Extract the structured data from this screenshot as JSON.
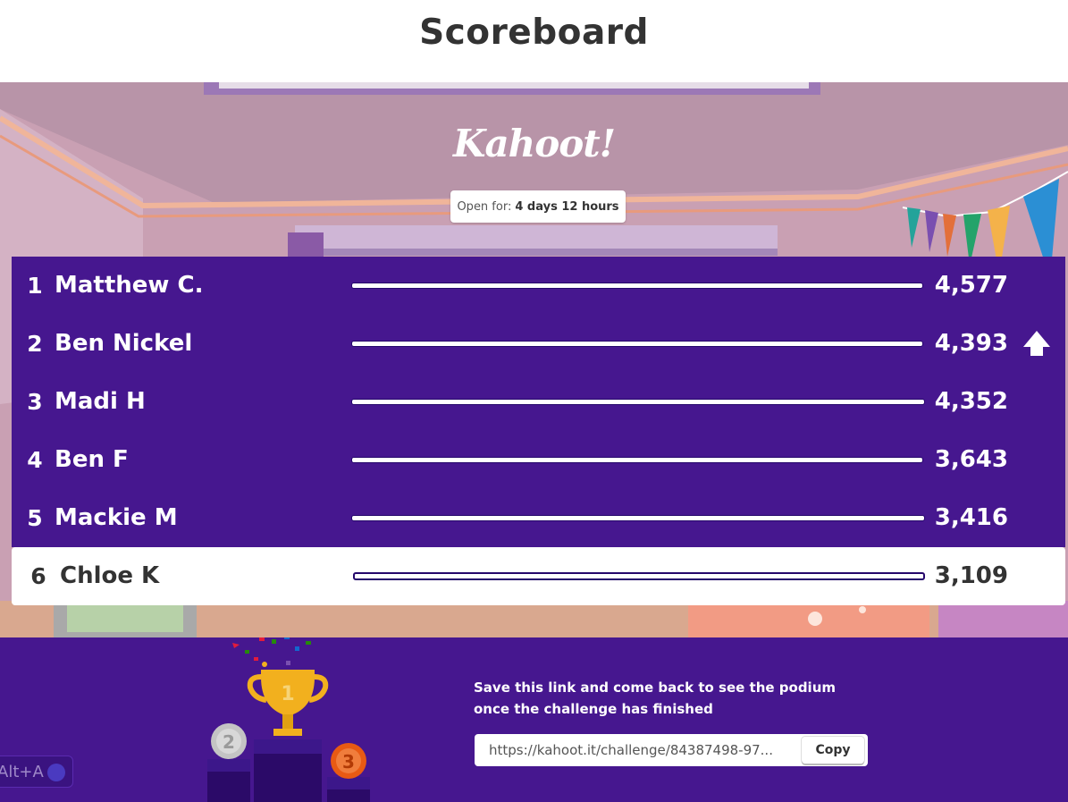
{
  "header": {
    "title": "Scoreboard"
  },
  "brand": {
    "logo_text": "Kahoot!"
  },
  "open_for": {
    "label": "Open for:",
    "value": "4 days 12 hours"
  },
  "leaderboard": [
    {
      "rank": "1",
      "name": "Matthew C.",
      "score": "4,577",
      "progress": 1.0,
      "trend": ""
    },
    {
      "rank": "2",
      "name": "Ben Nickel",
      "score": "4,393",
      "progress": 1.0,
      "trend": "up"
    },
    {
      "rank": "3",
      "name": "Madi H",
      "score": "4,352",
      "progress": 1.0,
      "trend": ""
    },
    {
      "rank": "4",
      "name": "Ben F",
      "score": "3,643",
      "progress": 1.0,
      "trend": ""
    },
    {
      "rank": "5",
      "name": "Mackie M",
      "score": "3,416",
      "progress": 1.0,
      "trend": ""
    },
    {
      "rank": "6",
      "name": "Chloe K",
      "score": "3,109",
      "progress": 1.0,
      "trend": "",
      "is_current_player": true
    }
  ],
  "footer": {
    "message": "Save this link and come back to see the podium once the challenge has finished",
    "link": "https://kahoot.it/challenge/84387498-97...",
    "copy_label": "Copy",
    "podium_labels": [
      "1",
      "2",
      "3"
    ]
  },
  "accessibility_badge": {
    "label": "Alt+A"
  },
  "colors": {
    "purple": "#46178f",
    "dark_purple": "#25076b",
    "gold": "#f2b01e",
    "bronze": "#e85a13",
    "silver": "#c4c4c4"
  },
  "icons": {
    "logo": "kahoot-logo",
    "trend_up": "arrow-up-icon",
    "trophy": "trophy-icon"
  }
}
